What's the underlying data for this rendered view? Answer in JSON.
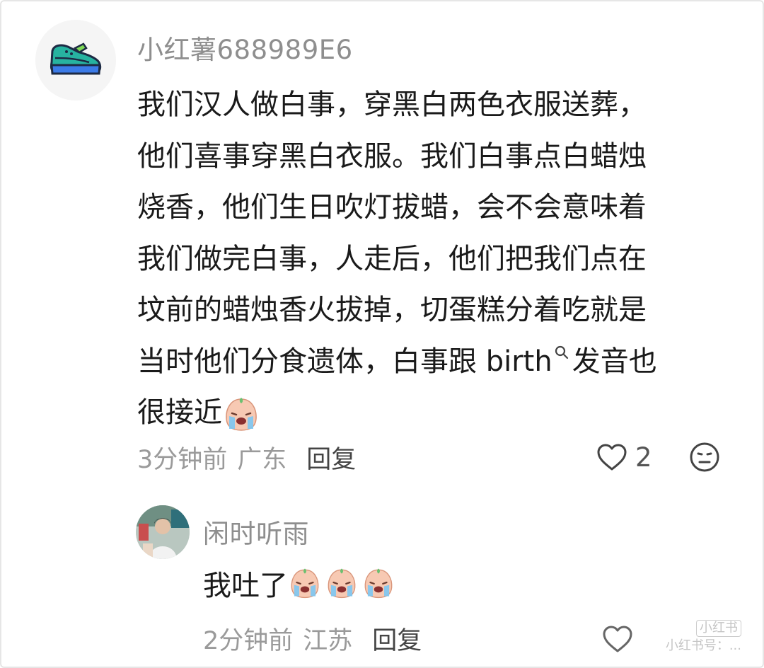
{
  "comment": {
    "username": "小红薯688989E6",
    "avatar_icon": "sneaker-icon",
    "lines": [
      "我们汉人做白事，穿黑白两色衣服送葬，",
      "他们喜事穿黑白衣服。我们白事点白蜡烛",
      "烧香，他们生日吹灯拔蜡，会不会意味着",
      "我们做完白事，人走后，他们把我们点在",
      "坟前的蜡烛香火拔掉，切蛋糕分着吃就是"
    ],
    "line6_before": "当时他们分食遗体，白事跟 birth",
    "line6_after": "发音也",
    "line7": "很接近",
    "time": "3分钟前",
    "location": "广东",
    "reply_label": "回复",
    "like_count": "2"
  },
  "reply": {
    "username": "闲时听雨",
    "avatar_icon": "person-photo-avatar",
    "text": "我吐了",
    "emoji_count_text": "",
    "time": "2分钟前",
    "location": "江苏",
    "reply_label": "回复"
  },
  "watermark": {
    "brand": "小红书",
    "text": "小红书号：..."
  },
  "colors": {
    "username": "#8e8e8e",
    "body_text": "#1a1a1a",
    "meta_text": "#9a9a9a",
    "reply_button": "#444444"
  }
}
